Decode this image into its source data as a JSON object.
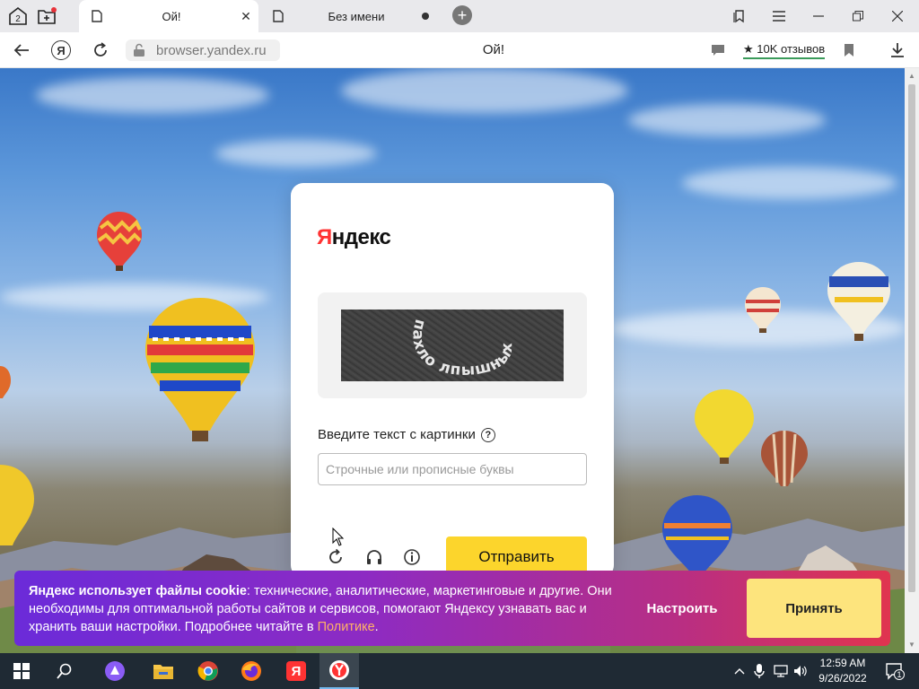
{
  "tabs": {
    "count_badge": "2",
    "active_title": "Ой!",
    "inactive_title": "Без имени",
    "close_glyph": "✕",
    "new_tab_glyph": "+"
  },
  "address_bar": {
    "url": "browser.yandex.ru",
    "page_title": "Ой!",
    "yandex_btn": "Я",
    "reviews": "★ 10K отзывов"
  },
  "captcha": {
    "logo_first": "Я",
    "logo_rest": "ндекс",
    "captcha_words": "пахло лпышных",
    "prompt": "Введите текст с картинки",
    "help_glyph": "?",
    "input_placeholder": "Строчные или прописные буквы",
    "input_value": "",
    "submit_label": "Отправить"
  },
  "cookie_banner": {
    "bold_lead": "Яндекс использует файлы cookie",
    "text_before_link": ": технические, аналитические, маркетинговые и другие. Они необходимы для оптимальной работы сайтов и сервисов, помогают Яндексу узнавать вас и хранить ваши настройки. Подробнее читайте в ",
    "link_text": "Политике",
    "text_after_link": ".",
    "settings_label": "Настроить",
    "accept_label": "Принять"
  },
  "taskbar": {
    "yandex_label": "Я",
    "time": "12:59 AM",
    "date": "9/26/2022",
    "notification_count": "1"
  },
  "colors": {
    "accent_yellow": "#fcd52c",
    "yandex_red": "#ff3333",
    "cookie_gradient_start": "#6b2bd9",
    "cookie_gradient_end": "#e0344f"
  }
}
